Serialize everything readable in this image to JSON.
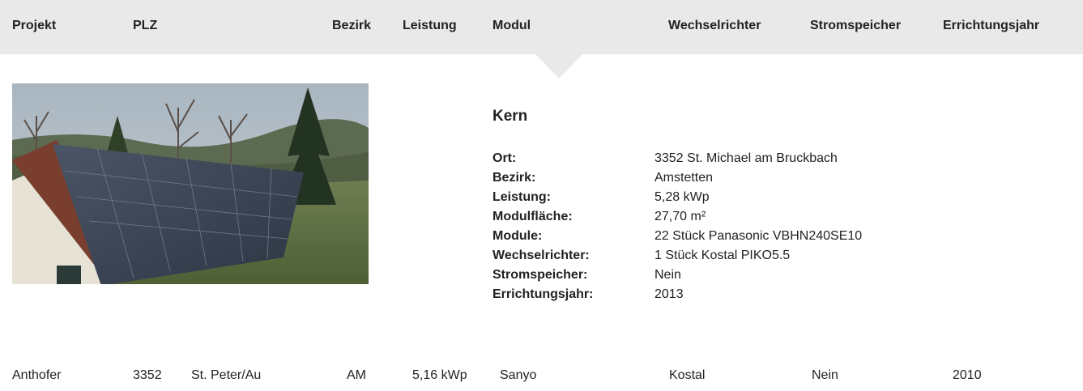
{
  "header": {
    "projekt": "Projekt",
    "plz": "PLZ",
    "bezirk": "Bezirk",
    "leistung": "Leistung",
    "modul": "Modul",
    "wechselrichter": "Wechselrichter",
    "stromspeicher": "Stromspeicher",
    "errichtungsjahr": "Errichtungsjahr"
  },
  "detail": {
    "title": "Kern",
    "fields": [
      {
        "label": "Ort:",
        "value": "3352 St. Michael am Bruckbach"
      },
      {
        "label": "Bezirk:",
        "value": "Amstetten"
      },
      {
        "label": "Leistung:",
        "value": "5,28 kWp"
      },
      {
        "label": "Modulfläche:",
        "value": "27,70 m²"
      },
      {
        "label": "Module:",
        "value": "22 Stück Panasonic VBHN240SE10"
      },
      {
        "label": "Wechselrichter:",
        "value": "1 Stück Kostal PIKO5.5"
      },
      {
        "label": "Stromspeicher:",
        "value": "Nein"
      },
      {
        "label": "Errichtungsjahr:",
        "value": "2013"
      }
    ]
  },
  "rows": [
    {
      "projekt": "Anthofer",
      "plz": "3352",
      "ort": "St. Peter/Au",
      "bezirk": "AM",
      "leistung": "5,16 kWp",
      "modul": "Sanyo",
      "wechselrichter": "Kostal",
      "stromspeicher": "Nein",
      "errichtungsjahr": "2010"
    }
  ]
}
